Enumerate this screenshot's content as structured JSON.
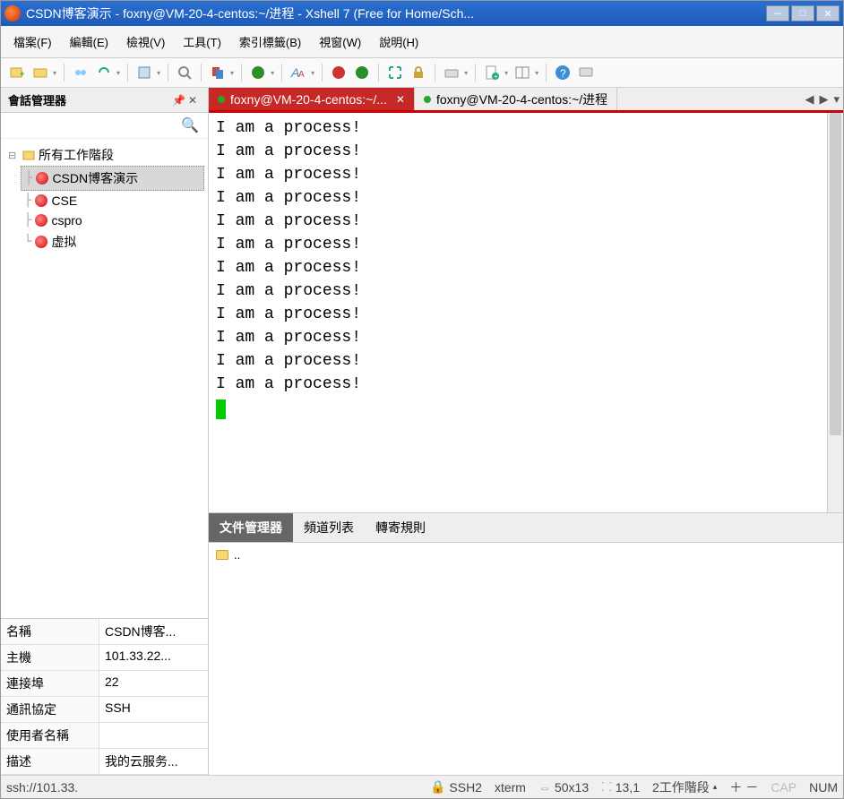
{
  "titlebar": {
    "text": "CSDN博客演示 - foxny@VM-20-4-centos:~/进程 - Xshell 7 (Free for Home/Sch..."
  },
  "menu": {
    "file": "檔案(F)",
    "edit": "編輯(E)",
    "view": "檢視(V)",
    "tools": "工具(T)",
    "bookmarks": "索引標籤(B)",
    "window": "視窗(W)",
    "help": "說明(H)"
  },
  "sidebar": {
    "title": "會話管理器",
    "root": "所有工作階段",
    "items": [
      {
        "label": "CSDN博客演示",
        "selected": true
      },
      {
        "label": "CSE",
        "selected": false
      },
      {
        "label": "cspro",
        "selected": false
      },
      {
        "label": "虚拟",
        "selected": false
      }
    ]
  },
  "props": [
    {
      "k": "名稱",
      "v": "CSDN博客..."
    },
    {
      "k": "主機",
      "v": "101.33.22..."
    },
    {
      "k": "連接埠",
      "v": "22"
    },
    {
      "k": "通訊協定",
      "v": "SSH"
    },
    {
      "k": "使用者名稱",
      "v": ""
    },
    {
      "k": "描述",
      "v": "我的云服务..."
    }
  ],
  "tabs": {
    "active": "foxny@VM-20-4-centos:~/...",
    "inactive": "foxny@VM-20-4-centos:~/进程"
  },
  "terminal_lines": [
    "I am a process!",
    "I am a process!",
    "I am a process!",
    "I am a process!",
    "I am a process!",
    "I am a process!",
    "I am a process!",
    "I am a process!",
    "I am a process!",
    "I am a process!",
    "I am a process!",
    "I am a process!"
  ],
  "bottom_tabs": {
    "file_manager": "文件管理器",
    "channel": "頻道列表",
    "forward": "轉寄規則"
  },
  "file_manager": {
    "up": ".."
  },
  "status": {
    "addr": "ssh://101.33.",
    "proto": "SSH2",
    "term": "xterm",
    "size": "50x13",
    "pos": "13,1",
    "sessions": "2工作階段",
    "cap": "CAP",
    "num": "NUM"
  }
}
